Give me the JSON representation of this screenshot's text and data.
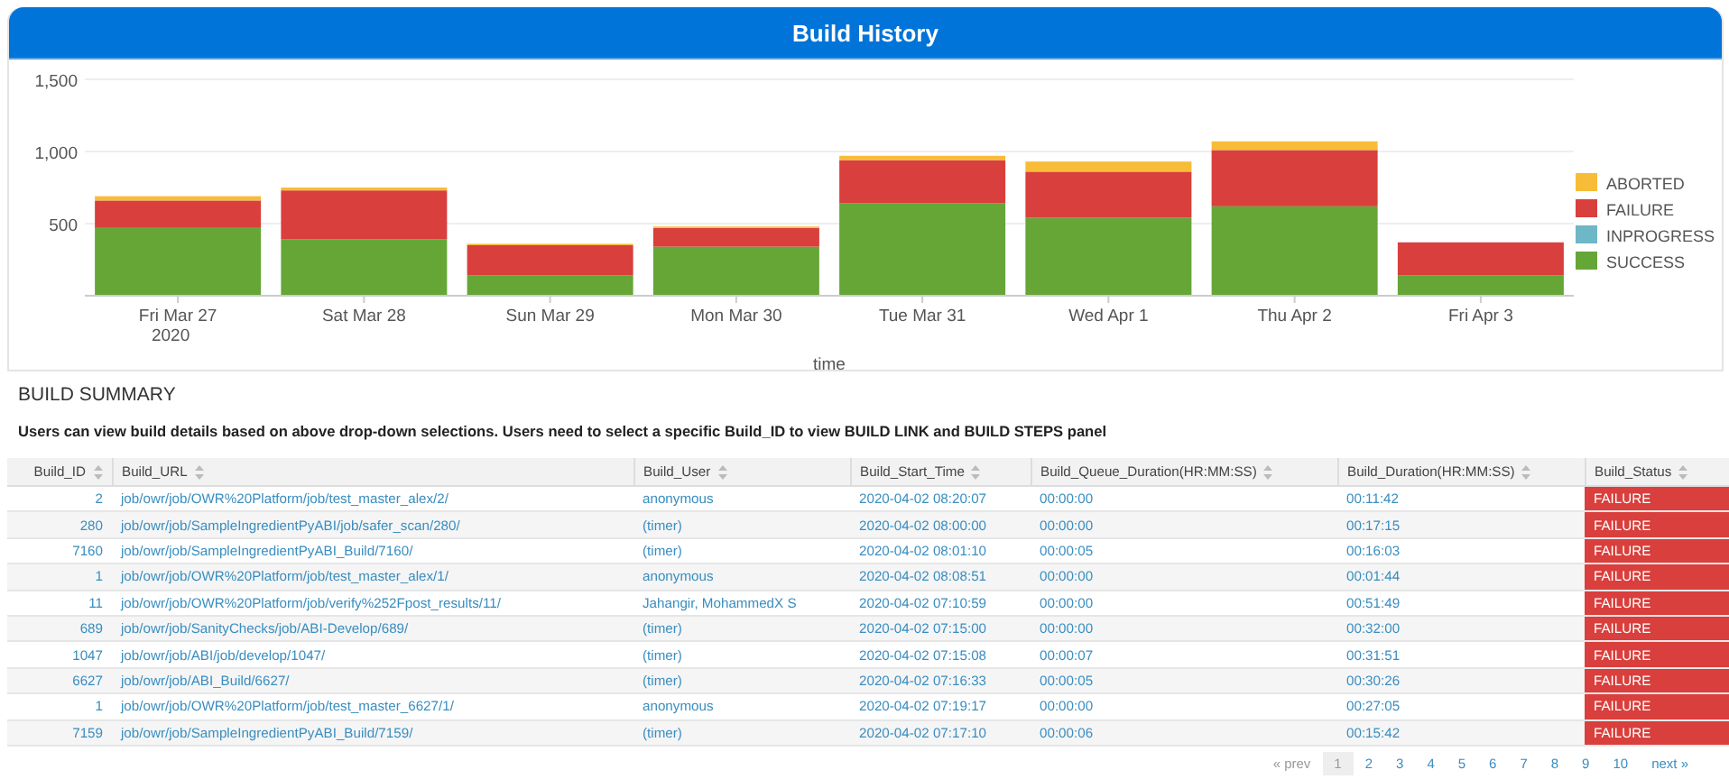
{
  "panel": {
    "title": "Build History"
  },
  "chart_data": {
    "type": "bar",
    "stacked": true,
    "xlabel": "time",
    "categories": [
      "Fri Mar 27",
      "Sat Mar 28",
      "Sun Mar 29",
      "Mon Mar 30",
      "Tue Mar 31",
      "Wed Apr 1",
      "Thu Apr 2",
      "Fri Apr 3"
    ],
    "ylim": [
      0,
      1500
    ],
    "yticks": [
      {
        "value": 500,
        "label": "500"
      },
      {
        "value": 1000,
        "label": "1,000"
      },
      {
        "value": 1500,
        "label": "1,500"
      }
    ],
    "annotations": [
      "2020"
    ],
    "legend": true,
    "series": [
      {
        "name": "SUCCESS",
        "color": "#65a637",
        "values": [
          470,
          390,
          140,
          340,
          640,
          540,
          620,
          140
        ]
      },
      {
        "name": "INPROGRESS",
        "color": "#6db7c6",
        "values": [
          0,
          0,
          0,
          0,
          0,
          0,
          0,
          0
        ]
      },
      {
        "name": "FAILURE",
        "color": "#d93f3c",
        "values": [
          190,
          340,
          210,
          130,
          300,
          320,
          390,
          230
        ]
      },
      {
        "name": "ABORTED",
        "color": "#f7bc38",
        "values": [
          30,
          20,
          10,
          10,
          30,
          70,
          60,
          0
        ]
      }
    ]
  },
  "summary": {
    "heading": "BUILD SUMMARY",
    "description": "Users can view build details based on above drop-down selections. Users need to select a specific Build_ID to view BUILD LINK and BUILD STEPS panel"
  },
  "table": {
    "columns": [
      "Build_ID",
      "Build_URL",
      "Build_User",
      "Build_Start_Time",
      "Build_Queue_Duration(HR:MM:SS)",
      "Build_Duration(HR:MM:SS)",
      "Build_Status"
    ],
    "rows": [
      [
        "2",
        "job/owr/job/OWR%20Platform/job/test_master_alex/2/",
        "anonymous",
        "2020-04-02 08:20:07",
        "00:00:00",
        "00:11:42",
        "FAILURE"
      ],
      [
        "280",
        "job/owr/job/SampleIngredientPyABI/job/safer_scan/280/",
        "(timer)",
        "2020-04-02 08:00:00",
        "00:00:00",
        "00:17:15",
        "FAILURE"
      ],
      [
        "7160",
        "job/owr/job/SampleIngredientPyABI_Build/7160/",
        "(timer)",
        "2020-04-02 08:01:10",
        "00:00:05",
        "00:16:03",
        "FAILURE"
      ],
      [
        "1",
        "job/owr/job/OWR%20Platform/job/test_master_alex/1/",
        "anonymous",
        "2020-04-02 08:08:51",
        "00:00:00",
        "00:01:44",
        "FAILURE"
      ],
      [
        "11",
        "job/owr/job/OWR%20Platform/job/verify%252Fpost_results/11/",
        "Jahangir, MohammedX S",
        "2020-04-02 07:10:59",
        "00:00:00",
        "00:51:49",
        "FAILURE"
      ],
      [
        "689",
        "job/owr/job/SanityChecks/job/ABI-Develop/689/",
        "(timer)",
        "2020-04-02 07:15:00",
        "00:00:00",
        "00:32:00",
        "FAILURE"
      ],
      [
        "1047",
        "job/owr/job/ABI/job/develop/1047/",
        "(timer)",
        "2020-04-02 07:15:08",
        "00:00:07",
        "00:31:51",
        "FAILURE"
      ],
      [
        "6627",
        "job/owr/job/ABI_Build/6627/",
        "(timer)",
        "2020-04-02 07:16:33",
        "00:00:05",
        "00:30:26",
        "FAILURE"
      ],
      [
        "1",
        "job/owr/job/OWR%20Platform/job/test_master_6627/1/",
        "anonymous",
        "2020-04-02 07:19:17",
        "00:00:00",
        "00:27:05",
        "FAILURE"
      ],
      [
        "7159",
        "job/owr/job/SampleIngredientPyABI_Build/7159/",
        "(timer)",
        "2020-04-02 07:17:10",
        "00:00:06",
        "00:15:42",
        "FAILURE"
      ]
    ]
  },
  "pagination": {
    "prev": "« prev",
    "next": "next »",
    "pages": [
      {
        "label": "1",
        "selected": true
      },
      {
        "label": "2",
        "selected": false
      },
      {
        "label": "3",
        "selected": false
      },
      {
        "label": "4",
        "selected": false
      },
      {
        "label": "5",
        "selected": false
      },
      {
        "label": "6",
        "selected": false
      },
      {
        "label": "7",
        "selected": false
      },
      {
        "label": "8",
        "selected": false
      },
      {
        "label": "9",
        "selected": false
      },
      {
        "label": "10",
        "selected": false
      }
    ]
  }
}
